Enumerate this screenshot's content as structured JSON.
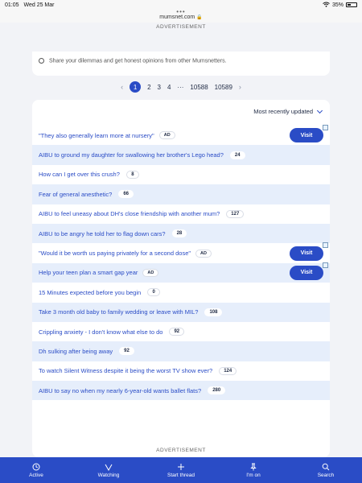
{
  "status": {
    "time": "01:05",
    "date": "Wed 25 Mar",
    "battery": "35%"
  },
  "browser": {
    "url": "mumsnet.com"
  },
  "ads": {
    "top_label": "ADVERTISEMENT",
    "bottom_label": "ADVERTISEMENT"
  },
  "partial_card": {
    "text": "Share your dilemmas and get honest opinions from other Mumsnetters."
  },
  "pagination": {
    "prev": "‹",
    "pages": [
      "1",
      "2",
      "3",
      "4"
    ],
    "current": "1",
    "ellipsis": "···",
    "last_pages": [
      "10588",
      "10589"
    ],
    "next": "›"
  },
  "sort": {
    "label": "Most recently updated"
  },
  "threads": [
    {
      "title": "\"They also generally learn more at nursery\"",
      "badge": "AD",
      "is_ad": true,
      "cta": "Visit"
    },
    {
      "title": "AIBU to ground my daughter for swallowing her brother's Lego head?",
      "badge": "24"
    },
    {
      "title": "How can I get over this crush?",
      "badge": "8"
    },
    {
      "title": "Fear of general anesthetic?",
      "badge": "66"
    },
    {
      "title": "AIBU to feel uneasy about DH's close friendship with another mum?",
      "badge": "127"
    },
    {
      "title": "AIBU to be angry he told her to flag down cars?",
      "badge": "28"
    },
    {
      "title": "\"Would it be worth us paying privately for a second dose\"",
      "badge": "AD",
      "is_ad": true,
      "cta": "Visit"
    },
    {
      "title": "Help your teen plan a smart gap year",
      "badge": "AD",
      "is_ad": true,
      "cta": "Visit"
    },
    {
      "title": "15 Minutes expected before you begin",
      "badge": "0"
    },
    {
      "title": "Take 3 month old baby to family wedding or leave with MIL?",
      "badge": "108"
    },
    {
      "title": "Crippling anxiety - I don't know what else to do",
      "badge": "92"
    },
    {
      "title": "Dh sulking after being away",
      "badge": "92"
    },
    {
      "title": "To watch Silent Witness despite it being the worst TV show ever?",
      "badge": "124"
    },
    {
      "title": "AIBU to say no when my nearly 6-year-old wants ballet flats?",
      "badge": "280"
    }
  ],
  "tabbar": [
    {
      "label": "Active",
      "icon": "clock-icon"
    },
    {
      "label": "Watching",
      "icon": "watching-icon"
    },
    {
      "label": "Start thread",
      "icon": "plus-icon"
    },
    {
      "label": "I'm on",
      "icon": "pin-icon"
    },
    {
      "label": "Search",
      "icon": "search-icon"
    }
  ],
  "colors": {
    "accent": "#2a4cc6",
    "row_alt": "#e6eefb"
  }
}
